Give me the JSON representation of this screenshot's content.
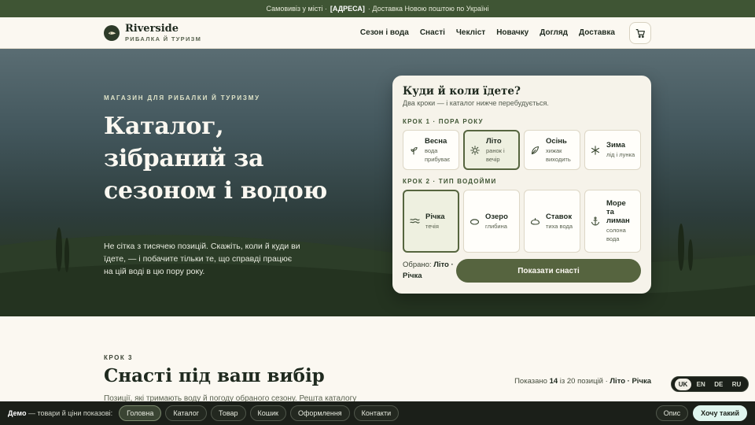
{
  "topbar": {
    "text_a": "Самовивіз у місті ·",
    "text_b": "[АДРЕСА]",
    "text_c": "· Доставка Новою поштою по Україні"
  },
  "header": {
    "brand": "Riverside",
    "tagline": "РИБАЛКА Й ТУРИЗМ",
    "nav": [
      "Сезон і вода",
      "Снасті",
      "Чекліст",
      "Новачку",
      "Догляд",
      "Доставка"
    ],
    "cart_icon": "cart-icon"
  },
  "hero": {
    "eyebrow": "МАГАЗИН ДЛЯ РИБАЛКИ Й ТУРИЗМУ",
    "title": "Каталог, зібраний за сезоном і водою",
    "lead": "Не сітка з тисячею позицій. Скажіть, коли й куди ви їдете, — і побачите тільки те, що справді працює на цій воді в цю пору року."
  },
  "selector": {
    "title": "Куди й коли їдете?",
    "subtitle": "Два кроки — і каталог нижче перебудується.",
    "step1_label": "КРОК 1 · ПОРА РОКУ",
    "seasons": [
      {
        "name": "Весна",
        "desc": "вода прибуває",
        "icon": "sprout-icon",
        "selected": false
      },
      {
        "name": "Літо",
        "desc": "ранок і вечір",
        "icon": "sun-icon",
        "selected": true
      },
      {
        "name": "Осінь",
        "desc": "хижак виходить",
        "icon": "leaf-icon",
        "selected": false
      },
      {
        "name": "Зима",
        "desc": "лід і лунка",
        "icon": "snowflake-icon",
        "selected": false
      }
    ],
    "step2_label": "КРОК 2 · ТИП ВОДОЙМИ",
    "waters": [
      {
        "name": "Річка",
        "desc": "течія",
        "icon": "waves-icon",
        "selected": true
      },
      {
        "name": "Озеро",
        "desc": "глибина",
        "icon": "lake-icon",
        "selected": false
      },
      {
        "name": "Ставок",
        "desc": "тиха вода",
        "icon": "pond-icon",
        "selected": false
      },
      {
        "name": "Море та лиман",
        "desc": "солона вода",
        "icon": "anchor-icon",
        "selected": false
      }
    ],
    "chosen_label": "Обрано:",
    "chosen_value": "Літо · Річка",
    "button": "Показати снасті"
  },
  "section": {
    "step_label": "КРОК 3",
    "title": "Снасті під ваш вибір",
    "desc": "Позиції, які тримають воду й погоду обраного сезону. Решта каталогу",
    "count_prefix": "Показано",
    "count_shown": "14",
    "count_mid": "із 20 позицій ·",
    "count_filter": "Літо · Річка"
  },
  "lang": {
    "options": [
      "UK",
      "EN",
      "DE",
      "RU"
    ],
    "active": "UK"
  },
  "demo": {
    "lead_bold": "Демо",
    "lead_rest": "— товари й ціни показові:",
    "pills": [
      "Головна",
      "Каталог",
      "Товар",
      "Кошик",
      "Оформлення",
      "Контакти"
    ],
    "desc_button": "Опис",
    "want_button": "Хочу такий"
  },
  "colors": {
    "accent": "#56643f",
    "topbar": "#3f5534",
    "background": "#fbf8f1",
    "demo_bar": "#1b1f19"
  }
}
